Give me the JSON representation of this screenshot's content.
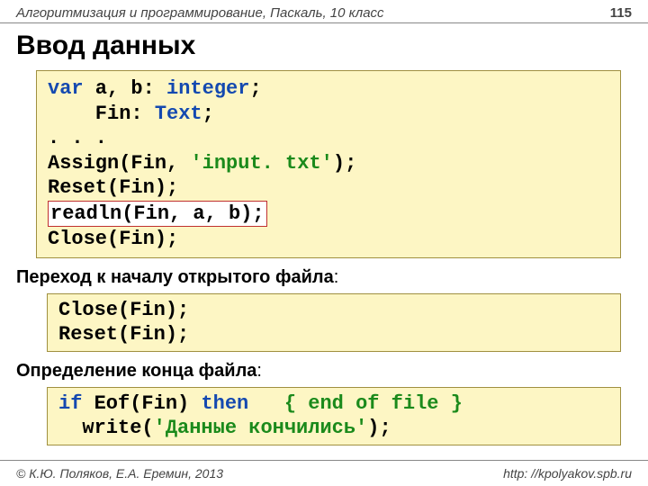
{
  "header": {
    "subject": "Алгоритмизация и программирование, Паскаль, 10 класс",
    "page": "115"
  },
  "title": "Ввод данных",
  "code1": {
    "l1a": "var",
    "l1b": " a, b: ",
    "l1c": "integer",
    "l1d": ";",
    "l2a": "    Fin: ",
    "l2b": "Text",
    "l2c": ";",
    "l3": ". . .",
    "l4a": "Assign(Fin, ",
    "l4b": "'input. txt'",
    "l4c": ");",
    "l5": "Reset(Fin);",
    "l6": "readln(Fin, a, b);",
    "l7": "Close(Fin);"
  },
  "section1": {
    "bold": "Переход к началу открытого файла",
    "tail": ":"
  },
  "code2": {
    "l1": "Close(Fin);",
    "l2": "Reset(Fin);"
  },
  "section2": {
    "bold": "Определение конца файла",
    "tail": ":"
  },
  "code3": {
    "l1a": "if",
    "l1b": " Eof(Fin) ",
    "l1c": "then",
    "l1d": "   ",
    "l1e": "{ end of file }",
    "l2a": "  write(",
    "l2b": "'Данные кончились'",
    "l2c": ");"
  },
  "footer": {
    "copyright": "© К.Ю. Поляков, Е.А. Еремин, 2013",
    "url": "http: //kpolyakov.spb.ru"
  }
}
